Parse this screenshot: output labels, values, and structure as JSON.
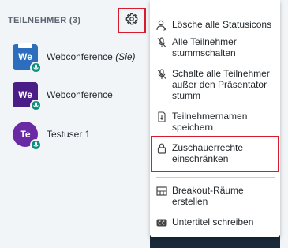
{
  "colors": {
    "highlight": "#d81c2e",
    "mic_badge": "#0f8f7b",
    "avatar_blue": "#2c6ebd",
    "avatar_purple": "#4b1e87",
    "avatar_violet": "#6a2aa3"
  },
  "panel": {
    "title": "TEILNEHMER (3)",
    "settings_icon": "gear-icon"
  },
  "users": [
    {
      "initials": "We",
      "name": "Webconference",
      "suffix": "(Sie)",
      "avatar_color": "#2c6ebd",
      "shape": "square",
      "presenter": true
    },
    {
      "initials": "We",
      "name": "Webconference",
      "suffix": "",
      "avatar_color": "#4b1e87",
      "shape": "square",
      "presenter": false
    },
    {
      "initials": "Te",
      "name": "Testuser 1",
      "suffix": "",
      "avatar_color": "#6a2aa3",
      "shape": "circle",
      "presenter": false
    }
  ],
  "menu": {
    "items": [
      {
        "label": "Lösche alle Statusicons",
        "icon": "user-clear-icon"
      },
      {
        "label": "Alle Teilnehmer stummschalten",
        "icon": "mic-mute-icon"
      },
      {
        "label": "Schalte alle Teilnehmer außer den Präsentator stumm",
        "icon": "mic-mute-icon"
      },
      {
        "label": "Teilnehmernamen speichern",
        "icon": "download-icon"
      },
      {
        "label": "Zuschauerrechte einschränken",
        "icon": "lock-icon"
      },
      {
        "label": "Breakout-Räume erstellen",
        "icon": "breakout-rooms-icon"
      },
      {
        "label": "Untertitel schreiben",
        "icon": "closed-captions-icon"
      }
    ]
  }
}
